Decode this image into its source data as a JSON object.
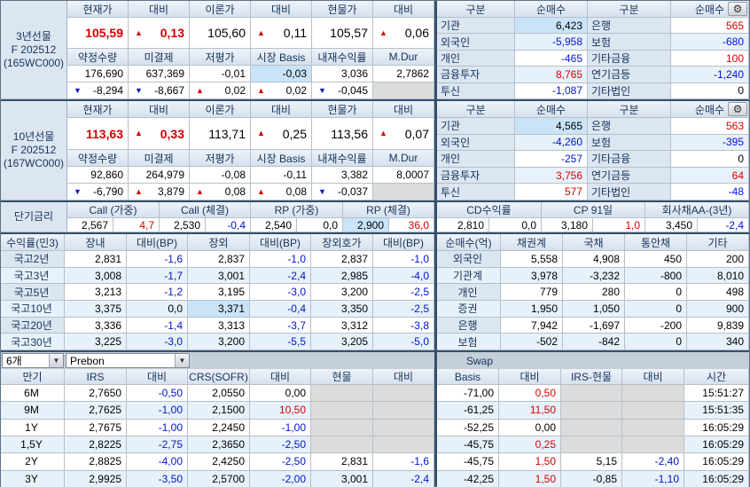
{
  "colors": {
    "up_red": "#d40000",
    "down_blue": "#0014cc",
    "highlight": "#c9e4f8",
    "header_bg": "#dce6f1",
    "section_border": "#35506b"
  },
  "futures_section": {
    "price_headers": [
      "현재가",
      "대비",
      "이론가",
      "대비",
      "현물가",
      "대비"
    ],
    "stat_headers": [
      "약정수량",
      "미결제",
      "저평가",
      "시장 Basis",
      "내재수익률",
      "M.Dur"
    ],
    "panels": [
      {
        "label_lines": [
          "3년선물",
          "F 202512",
          "(165WC000)"
        ],
        "price": [
          {
            "t": "105,59",
            "c": "r",
            "b": true
          },
          {
            "t": "0,13",
            "c": "r",
            "b": true,
            "a": "u"
          },
          {
            "t": "105,60"
          },
          {
            "t": "0,11",
            "a": "u"
          },
          {
            "t": "105,57"
          },
          {
            "t": "0,06",
            "a": "u"
          }
        ],
        "stat": [
          {
            "t": "176,690"
          },
          {
            "t": "637,369"
          },
          {
            "t": "-0,01"
          },
          {
            "t": "-0,03",
            "hl": true
          },
          {
            "t": "3,036"
          },
          {
            "t": "2,7862"
          }
        ],
        "chg": [
          {
            "t": "-8,294",
            "a": "d"
          },
          {
            "t": "-8,667",
            "a": "d"
          },
          {
            "t": "0,02",
            "a": "u"
          },
          {
            "t": "0,02",
            "a": "u"
          },
          {
            "t": "-0,045",
            "a": "d"
          },
          null
        ],
        "investors": {
          "headers": [
            "구분",
            "순매수",
            "구분",
            "순매수"
          ],
          "rows": [
            {
              "l": "기관",
              "v": {
                "t": "6,423",
                "hl": true
              },
              "l2": "은행",
              "v2": {
                "t": "565",
                "c": "r"
              }
            },
            {
              "l": "외국인",
              "v": {
                "t": "-5,958",
                "c": "b"
              },
              "l2": "보험",
              "v2": {
                "t": "-680",
                "c": "b"
              }
            },
            {
              "l": "개인",
              "v": {
                "t": "-465",
                "c": "b"
              },
              "l2": "기타금융",
              "v2": {
                "t": "100",
                "c": "r"
              }
            },
            {
              "l": "금융투자",
              "v": {
                "t": "8,765",
                "c": "r"
              },
              "l2": "연기금등",
              "v2": {
                "t": "-1,240",
                "c": "b"
              }
            },
            {
              "l": "투신",
              "v": {
                "t": "-1,087",
                "c": "b"
              },
              "l2": "기타법인",
              "v2": {
                "t": "0"
              }
            }
          ]
        }
      },
      {
        "label_lines": [
          "10년선물",
          "F 202512",
          "(167WC000)"
        ],
        "price": [
          {
            "t": "113,63",
            "c": "r",
            "b": true
          },
          {
            "t": "0,33",
            "c": "r",
            "b": true,
            "a": "u"
          },
          {
            "t": "113,71"
          },
          {
            "t": "0,25",
            "a": "u"
          },
          {
            "t": "113,56"
          },
          {
            "t": "0,07",
            "a": "u"
          }
        ],
        "stat": [
          {
            "t": "92,860"
          },
          {
            "t": "264,979"
          },
          {
            "t": "-0,08"
          },
          {
            "t": "-0,11"
          },
          {
            "t": "3,382"
          },
          {
            "t": "8,0007"
          }
        ],
        "chg": [
          {
            "t": "-6,790",
            "a": "d"
          },
          {
            "t": "3,879",
            "a": "u"
          },
          {
            "t": "0,08",
            "a": "u"
          },
          {
            "t": "0,08",
            "a": "u"
          },
          {
            "t": "-0,037",
            "a": "d"
          },
          null
        ],
        "investors": {
          "headers": [
            "구분",
            "순매수",
            "구분",
            "순매수"
          ],
          "rows": [
            {
              "l": "기관",
              "v": {
                "t": "4,565",
                "hl": true
              },
              "l2": "은행",
              "v2": {
                "t": "563",
                "c": "r"
              }
            },
            {
              "l": "외국인",
              "v": {
                "t": "-4,260",
                "c": "b"
              },
              "l2": "보험",
              "v2": {
                "t": "-395",
                "c": "b"
              }
            },
            {
              "l": "개인",
              "v": {
                "t": "-257",
                "c": "b"
              },
              "l2": "기타금융",
              "v2": {
                "t": "0"
              }
            },
            {
              "l": "금융투자",
              "v": {
                "t": "3,756",
                "c": "r"
              },
              "l2": "연기금등",
              "v2": {
                "t": "64",
                "c": "r"
              }
            },
            {
              "l": "투신",
              "v": {
                "t": "577",
                "c": "r"
              },
              "l2": "기타법인",
              "v2": {
                "t": "-48",
                "c": "b"
              }
            }
          ]
        }
      }
    ]
  },
  "rates_section": {
    "label": "단기금리",
    "left_groups": [
      {
        "h": "Call (가중)",
        "v": {
          "t": "2,567"
        },
        "d": {
          "t": "4,7",
          "c": "r"
        }
      },
      {
        "h": "Call (체결)",
        "v": {
          "t": "2,530"
        },
        "d": {
          "t": "-0,4",
          "c": "b"
        }
      },
      {
        "h": "RP (가중)",
        "v": {
          "t": "2,540"
        },
        "d": {
          "t": "0,0"
        }
      },
      {
        "h": "RP (체결)",
        "v": {
          "t": "2,900",
          "hl": true
        },
        "d": {
          "t": "36,0",
          "c": "r"
        }
      }
    ],
    "right_groups": [
      {
        "h": "CD수익률",
        "v": {
          "t": "2,810"
        },
        "d": {
          "t": "0,0"
        }
      },
      {
        "h": "CP 91일",
        "v": {
          "t": "3,180"
        },
        "d": {
          "t": "1,0",
          "c": "r"
        }
      },
      {
        "h": "회사채AA-(3년)",
        "v": {
          "t": "3,450"
        },
        "d": {
          "t": "-2,4",
          "c": "b"
        }
      }
    ]
  },
  "bond_section": {
    "headers": [
      "수익률(민3)",
      "장내",
      "대비(BP)",
      "장외",
      "대비(BP)",
      "장외호가",
      "대비(BP)"
    ],
    "rows": [
      {
        "label": "국고2년",
        "cells": [
          {
            "t": "2,831"
          },
          {
            "t": "-1,6",
            "c": "b"
          },
          {
            "t": "2,837"
          },
          {
            "t": "-1,0",
            "c": "b"
          },
          {
            "t": "2,837"
          },
          {
            "t": "-1,0",
            "c": "b"
          }
        ]
      },
      {
        "label": "국고3년",
        "cells": [
          {
            "t": "3,008"
          },
          {
            "t": "-1,7",
            "c": "b"
          },
          {
            "t": "3,001"
          },
          {
            "t": "-2,4",
            "c": "b"
          },
          {
            "t": "2,985"
          },
          {
            "t": "-4,0",
            "c": "b"
          }
        ]
      },
      {
        "label": "국고5년",
        "cells": [
          {
            "t": "3,213"
          },
          {
            "t": "-1,2",
            "c": "b"
          },
          {
            "t": "3,195"
          },
          {
            "t": "-3,0",
            "c": "b"
          },
          {
            "t": "3,200"
          },
          {
            "t": "-2,5",
            "c": "b"
          }
        ]
      },
      {
        "label": "국고10년",
        "cells": [
          {
            "t": "3,375"
          },
          {
            "t": "0,0"
          },
          {
            "t": "3,371",
            "hl": true
          },
          {
            "t": "-0,4",
            "c": "b"
          },
          {
            "t": "3,350"
          },
          {
            "t": "-2,5",
            "c": "b"
          }
        ]
      },
      {
        "label": "국고20년",
        "cells": [
          {
            "t": "3,336"
          },
          {
            "t": "-1,4",
            "c": "b"
          },
          {
            "t": "3,313"
          },
          {
            "t": "-3,7",
            "c": "b"
          },
          {
            "t": "3,312"
          },
          {
            "t": "-3,8",
            "c": "b"
          }
        ]
      },
      {
        "label": "국고30년",
        "cells": [
          {
            "t": "3,225"
          },
          {
            "t": "-3,0",
            "c": "b"
          },
          {
            "t": "3,200"
          },
          {
            "t": "-5,5",
            "c": "b"
          },
          {
            "t": "3,205"
          },
          {
            "t": "-5,0",
            "c": "b"
          }
        ]
      }
    ],
    "netbuy": {
      "headers": [
        "순매수(억)",
        "채권계",
        "국채",
        "통안채",
        "기타"
      ],
      "rows": [
        {
          "label": "외국인",
          "cells": [
            {
              "t": "5,558"
            },
            {
              "t": "4,908"
            },
            {
              "t": "450"
            },
            {
              "t": "200"
            }
          ]
        },
        {
          "label": "기관계",
          "cells": [
            {
              "t": "3,978"
            },
            {
              "t": "-3,232"
            },
            {
              "t": "-800"
            },
            {
              "t": "8,010"
            }
          ]
        },
        {
          "label": "개인",
          "cells": [
            {
              "t": "779"
            },
            {
              "t": "280"
            },
            {
              "t": "0"
            },
            {
              "t": "498"
            }
          ]
        },
        {
          "label": "증권",
          "cells": [
            {
              "t": "1,950"
            },
            {
              "t": "1,050"
            },
            {
              "t": "0"
            },
            {
              "t": "900"
            }
          ]
        },
        {
          "label": "은행",
          "cells": [
            {
              "t": "7,942"
            },
            {
              "t": "-1,697"
            },
            {
              "t": "-200"
            },
            {
              "t": "9,839"
            }
          ]
        },
        {
          "label": "보험",
          "cells": [
            {
              "t": "-502"
            },
            {
              "t": "-842"
            },
            {
              "t": "0"
            },
            {
              "t": "340"
            }
          ]
        }
      ]
    }
  },
  "swap_section": {
    "filters": [
      "6개",
      "Prebon"
    ],
    "title": "Swap",
    "headers": [
      "만기",
      "IRS",
      "대비",
      "CRS(SOFR)",
      "대비",
      "현물",
      "대비",
      "Basis",
      "대비",
      "IRS-현물",
      "대비",
      "시간"
    ],
    "rows": [
      {
        "m": "6M",
        "cells": [
          {
            "t": "2,7650"
          },
          {
            "t": "-0,50",
            "c": "b"
          },
          {
            "t": "2,0550"
          },
          {
            "t": "0,00"
          },
          null,
          null,
          {
            "t": "-71,00"
          },
          {
            "t": "0,50",
            "c": "r"
          },
          null,
          null
        ],
        "time": "15:51:27"
      },
      {
        "m": "9M",
        "cells": [
          {
            "t": "2,7625"
          },
          {
            "t": "-1,00",
            "c": "b"
          },
          {
            "t": "2,1500"
          },
          {
            "t": "10,50",
            "c": "r"
          },
          null,
          null,
          {
            "t": "-61,25"
          },
          {
            "t": "11,50",
            "c": "r"
          },
          null,
          null
        ],
        "time": "15:51:35"
      },
      {
        "m": "1Y",
        "cells": [
          {
            "t": "2,7675"
          },
          {
            "t": "-1,00",
            "c": "b"
          },
          {
            "t": "2,2450"
          },
          {
            "t": "-1,00",
            "c": "b"
          },
          null,
          null,
          {
            "t": "-52,25"
          },
          {
            "t": "0,00"
          },
          null,
          null
        ],
        "time": "16:05:29"
      },
      {
        "m": "1,5Y",
        "cells": [
          {
            "t": "2,8225"
          },
          {
            "t": "-2,75",
            "c": "b"
          },
          {
            "t": "2,3650"
          },
          {
            "t": "-2,50",
            "c": "b"
          },
          null,
          null,
          {
            "t": "-45,75"
          },
          {
            "t": "0,25",
            "c": "r"
          },
          null,
          null
        ],
        "time": "16:05:29"
      },
      {
        "m": "2Y",
        "cells": [
          {
            "t": "2,8825"
          },
          {
            "t": "-4,00",
            "c": "b"
          },
          {
            "t": "2,4250"
          },
          {
            "t": "-2,50",
            "c": "b"
          },
          {
            "t": "2,831"
          },
          {
            "t": "-1,6",
            "c": "b"
          },
          {
            "t": "-45,75"
          },
          {
            "t": "1,50",
            "c": "r"
          },
          {
            "t": "5,15"
          },
          {
            "t": "-2,40",
            "c": "b"
          }
        ],
        "time": "16:05:29"
      },
      {
        "m": "3Y",
        "cells": [
          {
            "t": "2,9925"
          },
          {
            "t": "-3,50",
            "c": "b"
          },
          {
            "t": "2,5700"
          },
          {
            "t": "-2,00",
            "c": "b"
          },
          {
            "t": "3,001"
          },
          {
            "t": "-2,4",
            "c": "b"
          },
          {
            "t": "-42,25"
          },
          {
            "t": "1,50",
            "c": "r"
          },
          {
            "t": "-0,85"
          },
          {
            "t": "-1,10",
            "c": "b"
          }
        ],
        "time": "16:05:29"
      }
    ]
  }
}
